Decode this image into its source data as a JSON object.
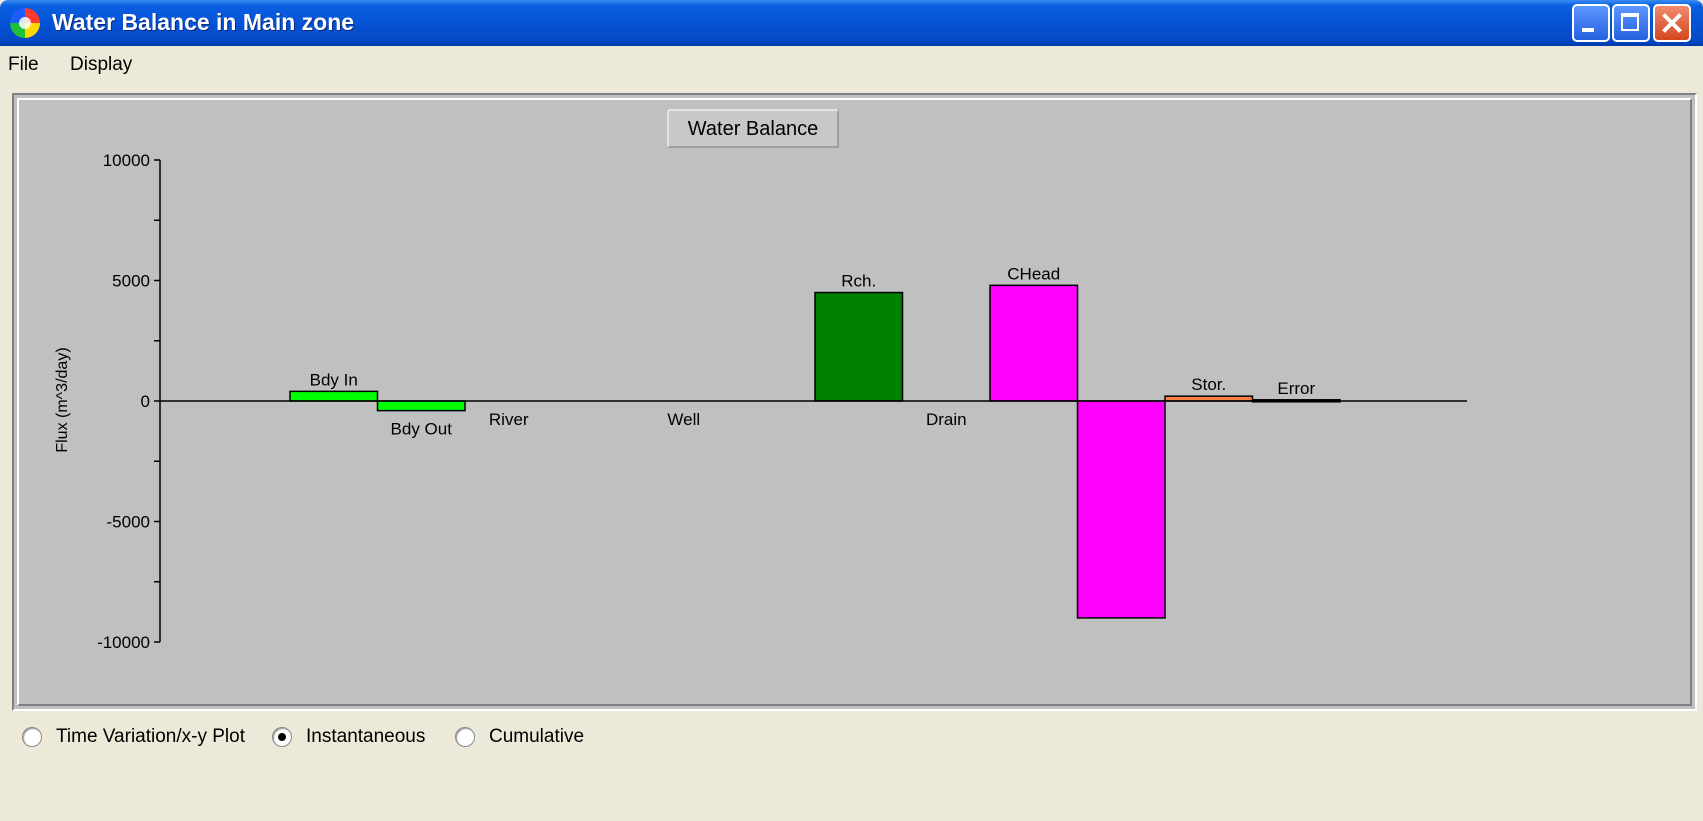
{
  "window": {
    "title": "Water Balance in Main zone"
  },
  "menu": {
    "file": "File",
    "display": "Display"
  },
  "radio_options": [
    {
      "label": "Time Variation/x-y Plot",
      "checked": false
    },
    {
      "label": "Instantaneous",
      "checked": true
    },
    {
      "label": "Cumulative",
      "checked": false
    }
  ],
  "chart_data": {
    "type": "bar",
    "title": "Water Balance",
    "ylabel": "Flux (m^3/day)",
    "xlabel": "",
    "ylim": [
      -10000,
      10000
    ],
    "yticks": [
      10000,
      5000,
      0,
      -5000,
      -10000
    ],
    "grid": false,
    "bars": [
      {
        "label": "Bdy In",
        "value": 400,
        "color": "#00FF00"
      },
      {
        "label": "Bdy Out",
        "value": -400,
        "color": "#00FF00"
      },
      {
        "label": "River",
        "value": 0,
        "color": "#00FF00"
      },
      {
        "label": "",
        "value": 0,
        "color": "#00FF00"
      },
      {
        "label": "Well",
        "value": 0,
        "color": "#00FF00"
      },
      {
        "label": "",
        "value": 0,
        "color": "#00FF00"
      },
      {
        "label": "Rch.",
        "value": 4500,
        "color": "#008000"
      },
      {
        "label": "Drain",
        "value": 0,
        "color": "#008000"
      },
      {
        "label": "CHead",
        "value": 4800,
        "color": "#FF00FF"
      },
      {
        "label": "",
        "value": -9000,
        "color": "#FF00FF"
      },
      {
        "label": "Stor.",
        "value": 200,
        "color": "#FF8040"
      },
      {
        "label": "Error",
        "value": 50,
        "color": "#000000"
      }
    ]
  }
}
